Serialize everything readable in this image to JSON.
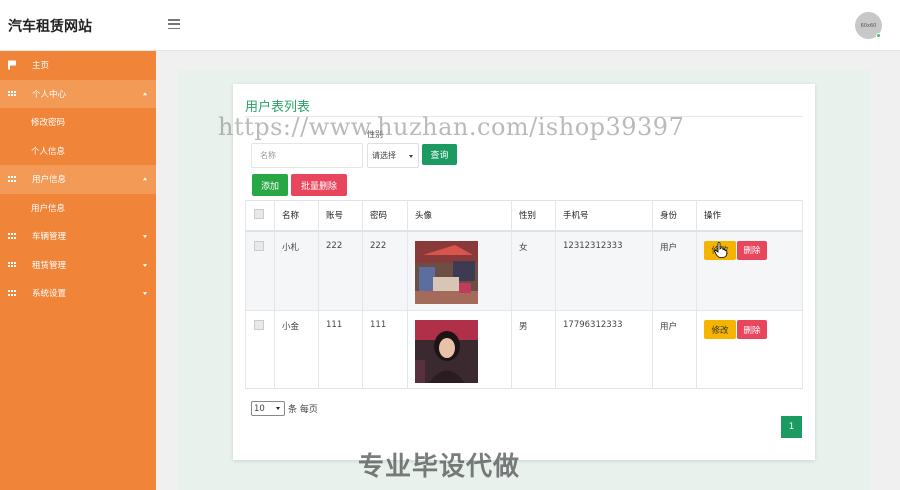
{
  "header": {
    "brand": "汽车租赁网站",
    "menu_icon": "hamburger-icon",
    "avatar_text": "60x60"
  },
  "sidebar": {
    "items": [
      {
        "label": "主页",
        "icon": "flag-icon",
        "type": "top"
      },
      {
        "label": "个人中心",
        "icon": "grid-icon",
        "type": "parent",
        "open": true
      },
      {
        "label": "修改密码",
        "type": "sub"
      },
      {
        "label": "个人信息",
        "type": "sub"
      },
      {
        "label": "用户信息",
        "icon": "grid-icon",
        "type": "parent",
        "open": true
      },
      {
        "label": "用户信息",
        "type": "sub"
      },
      {
        "label": "车辆管理",
        "icon": "grid-icon",
        "type": "parent",
        "open": false
      },
      {
        "label": "租赁管理",
        "icon": "grid-icon",
        "type": "parent",
        "open": false
      },
      {
        "label": "系统设置",
        "icon": "grid-icon",
        "type": "parent",
        "open": false
      }
    ]
  },
  "card": {
    "title": "用户表列表",
    "filter": {
      "name_placeholder": "名称",
      "gender_label": "性别",
      "gender_selected": "请选择",
      "search_label": "查询"
    },
    "add_label": "添加",
    "batch_delete_label": "批量删除"
  },
  "table": {
    "headers": [
      "名称",
      "账号",
      "密码",
      "头像",
      "性别",
      "手机号",
      "身份",
      "操作"
    ],
    "rows": [
      {
        "name": "小札",
        "account": "222",
        "password": "222",
        "gender": "女",
        "phone": "12312312333",
        "role": "用户"
      },
      {
        "name": "小金",
        "account": "111",
        "password": "111",
        "gender": "男",
        "phone": "17796312333",
        "role": "用户"
      }
    ],
    "edit_label": "修改",
    "delete_label": "删除"
  },
  "pagination": {
    "page_size": "10",
    "page_size_suffix": "条 每页",
    "current_page": "1"
  },
  "watermark": {
    "url": "https://www.huzhan.com/ishop39397",
    "text": "专业毕设代做"
  },
  "colors": {
    "sidebar": "#f0853a",
    "accent_green": "#1b9a62",
    "danger": "#e8465d",
    "warning": "#f4b400"
  }
}
